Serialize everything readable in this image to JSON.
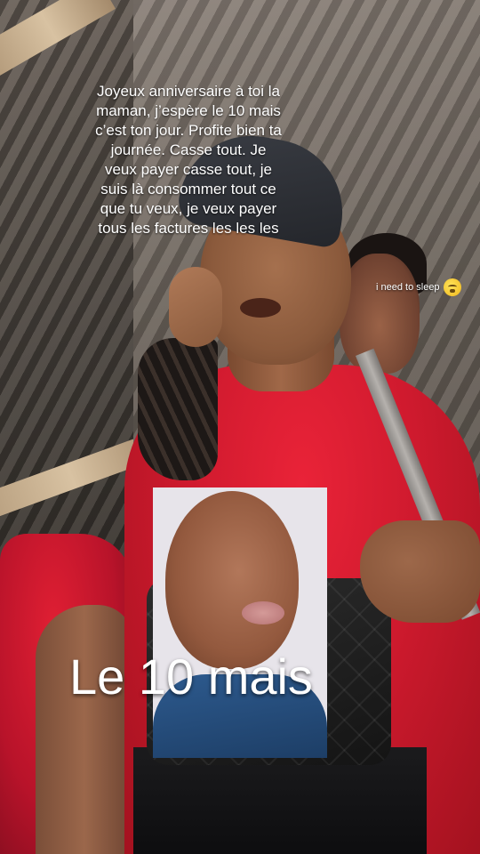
{
  "caption": {
    "text": "Joyeux anniversaire à toi la\nmaman, j’espère le 10  mais\nc’est ton jour. Profite bien ta\njournée. Casse tout. Je\nveux payer casse tout, je\nsuis là consommer tout ce\nque tu veux, je veux payer\ntous les factures les les les"
  },
  "side_note": {
    "text": "i need to sleep",
    "emoji_icon": "sleepy-face-emoji"
  },
  "headline": {
    "text": "Le 10 mais"
  },
  "colors": {
    "dress_red": "#d41b30",
    "roof_gray": "#5a524a",
    "text_white": "#ffffff"
  }
}
